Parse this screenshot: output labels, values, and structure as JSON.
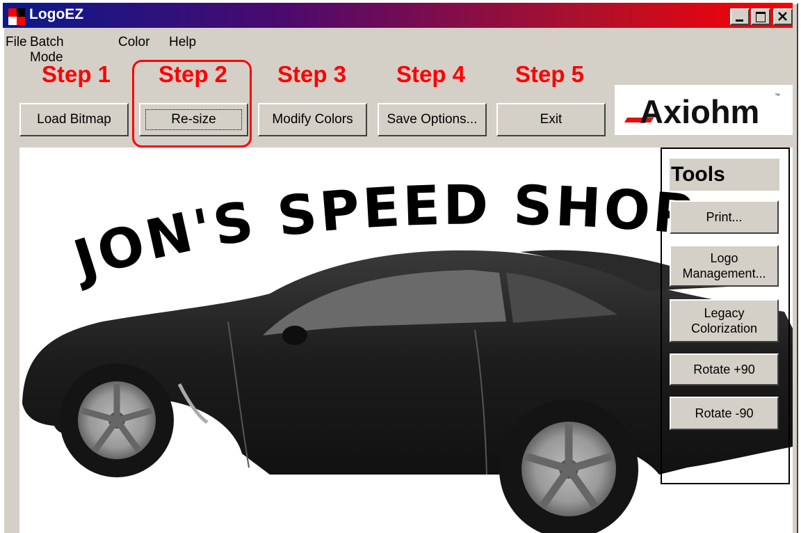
{
  "window": {
    "title": "LogoEZ"
  },
  "menu": [
    "File",
    "Batch Mode",
    "Color",
    "Help"
  ],
  "steps": [
    {
      "label": "Step 1",
      "button": "Load Bitmap"
    },
    {
      "label": "Step 2",
      "button": "Re-size"
    },
    {
      "label": "Step 3",
      "button": "Modify Colors"
    },
    {
      "label": "Step 4",
      "button": "Save Options..."
    },
    {
      "label": "Step 5",
      "button": "Exit"
    }
  ],
  "logo": {
    "text": "Axiohm"
  },
  "image": {
    "headline": "JON'S SPEED SHOP"
  },
  "tools": {
    "title": "Tools",
    "buttons": [
      "Print...",
      "Logo Management...",
      "Legacy Colorization",
      "Rotate +90",
      "Rotate -90"
    ]
  },
  "colors": {
    "accent": "#ff0000",
    "face": "#d4d0c8"
  }
}
